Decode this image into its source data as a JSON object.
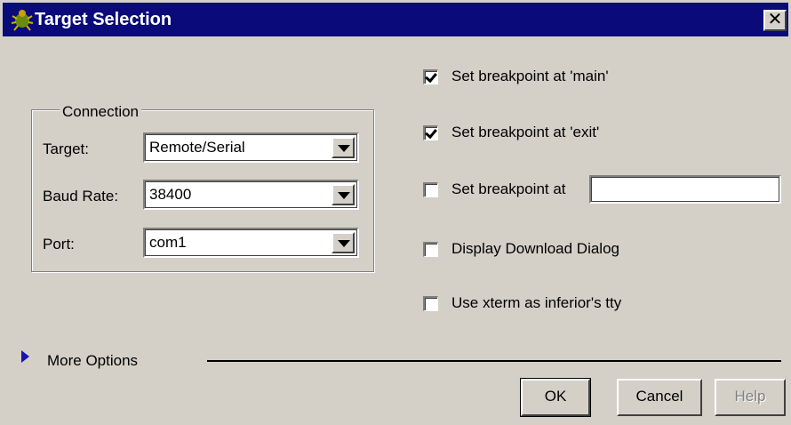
{
  "window": {
    "title": "Target Selection",
    "close_label": "✕"
  },
  "connection": {
    "group_label": "Connection",
    "target_label": "Target:",
    "target_value": "Remote/Serial",
    "baud_label": "Baud Rate:",
    "baud_value": "38400",
    "port_label": "Port:",
    "port_value": "com1"
  },
  "options": [
    {
      "label": "Set breakpoint at 'main'",
      "checked": true
    },
    {
      "label": "Set breakpoint at 'exit'",
      "checked": true
    },
    {
      "label": "Set breakpoint at",
      "checked": false
    },
    {
      "label": "Display Download Dialog",
      "checked": false
    },
    {
      "label": "Use xterm as inferior's tty",
      "checked": false
    }
  ],
  "breakpoint_at_value": "",
  "more_options_label": "More Options",
  "buttons": {
    "ok": "OK",
    "cancel": "Cancel",
    "help": "Help"
  }
}
